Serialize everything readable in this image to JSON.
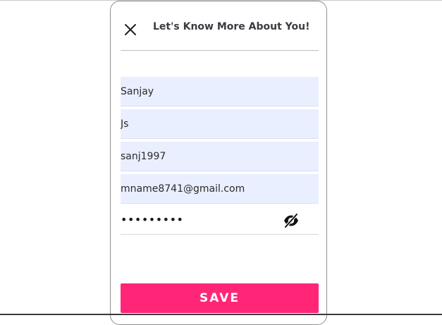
{
  "dialog": {
    "title": "Let's Know More About You!"
  },
  "form": {
    "first_name": "Sanjay",
    "last_name": "Js",
    "username": "sanj1997",
    "email": "mname8741@gmail.com",
    "password_masked": "•••••••••"
  },
  "actions": {
    "save_label": "SAVE"
  },
  "colors": {
    "accent": "#ff2677",
    "field_bg": "#e9efff"
  },
  "icons": {
    "close": "close-icon",
    "password_toggle": "eye-off-icon"
  }
}
